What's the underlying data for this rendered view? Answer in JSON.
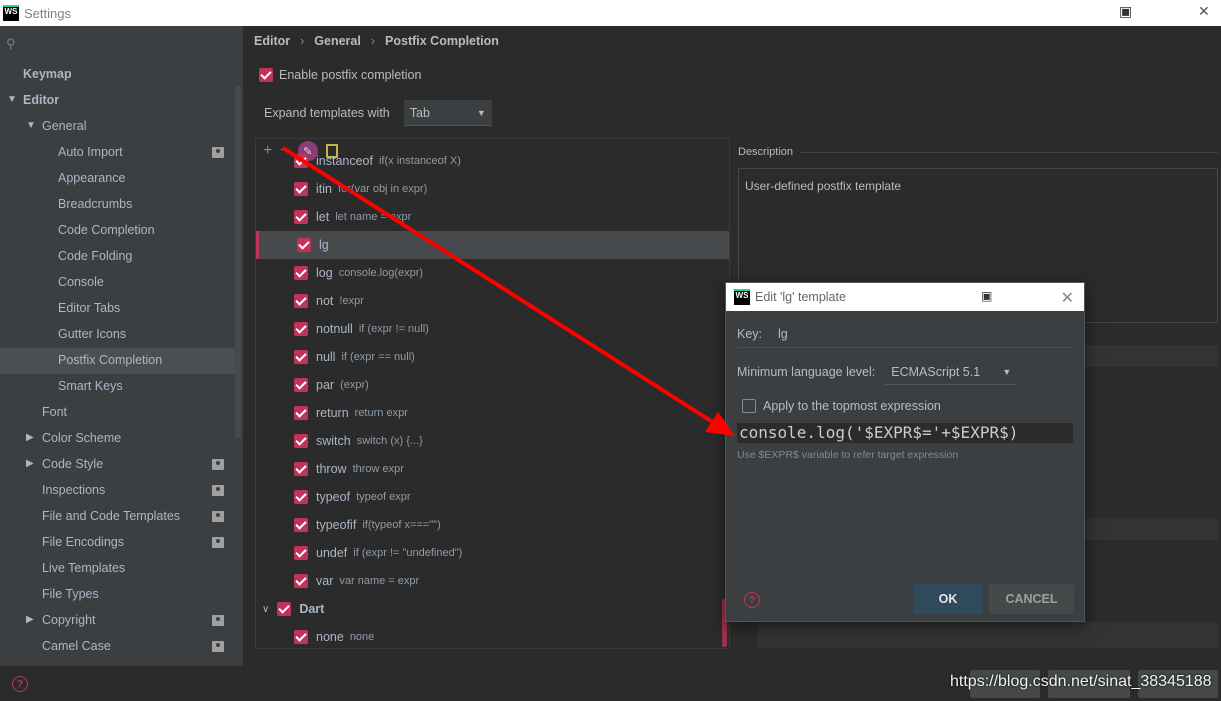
{
  "window": {
    "title": "Settings",
    "logo": "WS"
  },
  "sidebar": {
    "search_icon": "search-icon",
    "items": [
      {
        "label": "Keymap",
        "level": 0,
        "bold": true
      },
      {
        "label": "Editor",
        "level": 0,
        "bold": true,
        "expanded": true
      },
      {
        "label": "General",
        "level": 1,
        "expanded": true
      },
      {
        "label": "Auto Import",
        "level": 2,
        "profile": true
      },
      {
        "label": "Appearance",
        "level": 2
      },
      {
        "label": "Breadcrumbs",
        "level": 2
      },
      {
        "label": "Code Completion",
        "level": 2
      },
      {
        "label": "Code Folding",
        "level": 2
      },
      {
        "label": "Console",
        "level": 2
      },
      {
        "label": "Editor Tabs",
        "level": 2
      },
      {
        "label": "Gutter Icons",
        "level": 2
      },
      {
        "label": "Postfix Completion",
        "level": 2,
        "selected": true
      },
      {
        "label": "Smart Keys",
        "level": 2
      },
      {
        "label": "Font",
        "level": 1
      },
      {
        "label": "Color Scheme",
        "level": 1,
        "collapsed": true
      },
      {
        "label": "Code Style",
        "level": 1,
        "collapsed": true,
        "profile": true
      },
      {
        "label": "Inspections",
        "level": 1,
        "profile": true
      },
      {
        "label": "File and Code Templates",
        "level": 1,
        "profile": true
      },
      {
        "label": "File Encodings",
        "level": 1,
        "profile": true
      },
      {
        "label": "Live Templates",
        "level": 1
      },
      {
        "label": "File Types",
        "level": 1
      },
      {
        "label": "Copyright",
        "level": 1,
        "collapsed": true,
        "profile": true
      },
      {
        "label": "Camel Case",
        "level": 1,
        "profile": true
      }
    ]
  },
  "breadcrumb": [
    "Editor",
    "General",
    "Postfix Completion"
  ],
  "enable_postfix": {
    "label": "Enable postfix completion",
    "checked": true
  },
  "expand": {
    "label": "Expand templates with",
    "value": "Tab"
  },
  "templates": [
    {
      "key": "instanceof",
      "desc": "if(x instanceof X)"
    },
    {
      "key": "itin",
      "desc": "for(var obj in expr)"
    },
    {
      "key": "let",
      "desc": "let name = expr"
    },
    {
      "key": "lg",
      "desc": "",
      "selected": true
    },
    {
      "key": "log",
      "desc": "console.log(expr)"
    },
    {
      "key": "not",
      "desc": "!expr"
    },
    {
      "key": "notnull",
      "desc": "if (expr != null)"
    },
    {
      "key": "null",
      "desc": "if (expr == null)"
    },
    {
      "key": "par",
      "desc": "(expr)"
    },
    {
      "key": "return",
      "desc": "return expr"
    },
    {
      "key": "switch",
      "desc": "switch (x) {...}"
    },
    {
      "key": "throw",
      "desc": "throw expr"
    },
    {
      "key": "typeof",
      "desc": "typeof expr"
    },
    {
      "key": "typeofif",
      "desc": "if(typeof x===\"\")"
    },
    {
      "key": "undef",
      "desc": "if (expr != \"undefined\")"
    },
    {
      "key": "var",
      "desc": "var name = expr"
    },
    {
      "key": "Dart",
      "desc": "",
      "group": true
    },
    {
      "key": "none",
      "desc": "none"
    }
  ],
  "description": {
    "label": "Description",
    "text": "User-defined postfix template"
  },
  "dialog": {
    "title": "Edit 'lg' template",
    "key_label": "Key:",
    "key_value": "lg",
    "min_level_label": "Minimum language level:",
    "min_level_value": "ECMAScript 5.1",
    "apply_label": "Apply to the topmost expression",
    "apply_checked": false,
    "code": "console.log('$EXPR$='+$EXPR$)",
    "hint": "Use $EXPR$ variable to refer target expression",
    "ok_label": "OK",
    "cancel_label": "CANCEL"
  },
  "watermark": "https://blog.csdn.net/sinat_38345188",
  "accent_color": "#c3325a",
  "arrow_color": "#ff0000"
}
